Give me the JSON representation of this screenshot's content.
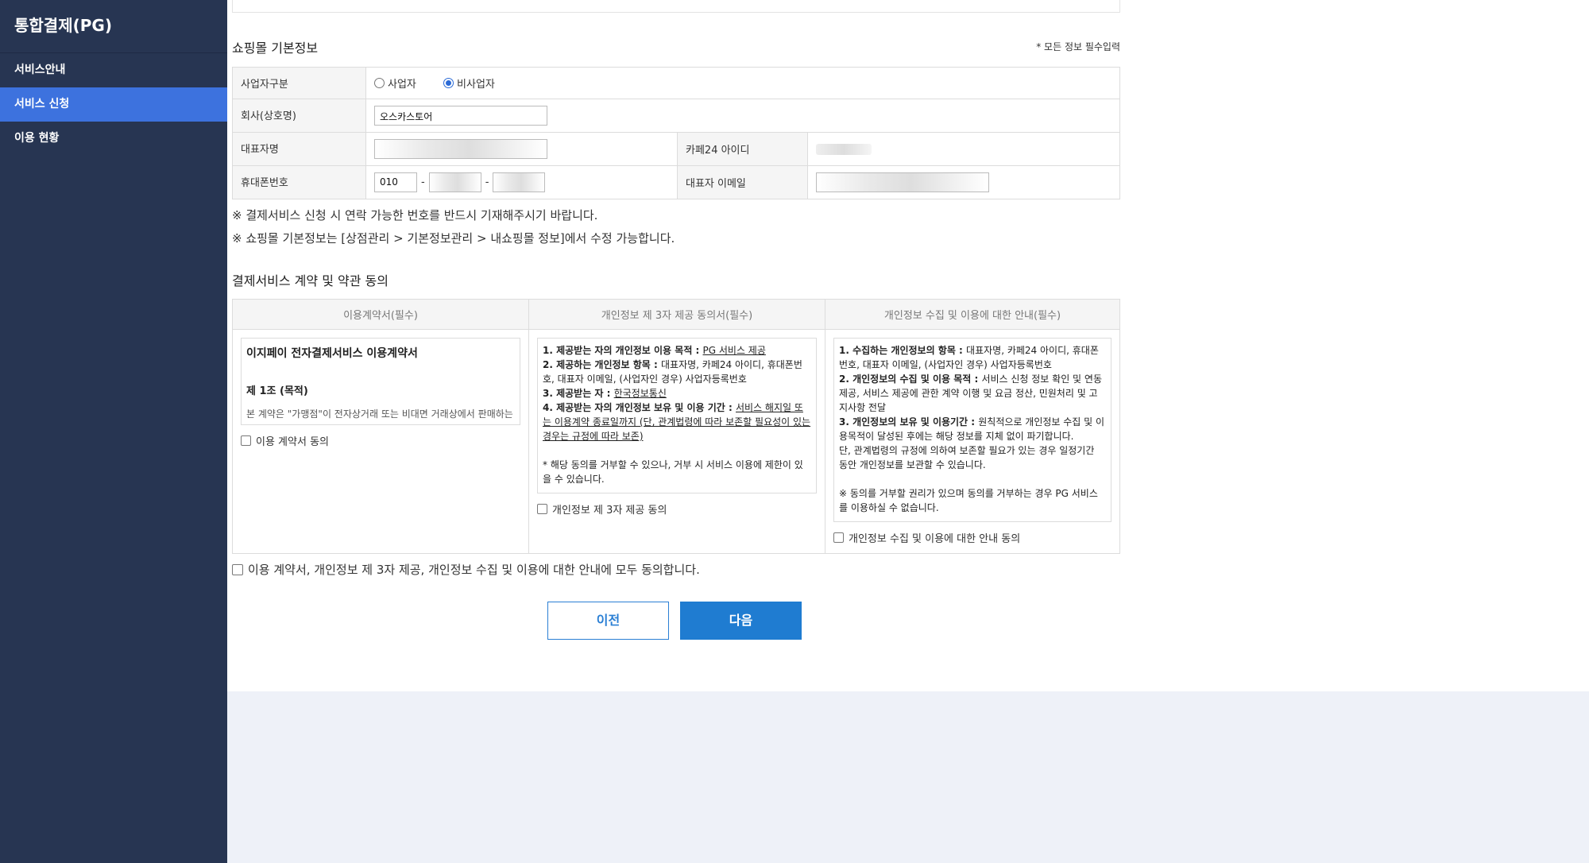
{
  "sidebar": {
    "title": "통합결제(PG)",
    "items": [
      {
        "label": "서비스안내",
        "active": false
      },
      {
        "label": "서비스 신청",
        "active": true
      },
      {
        "label": "이용 현황",
        "active": false
      }
    ]
  },
  "basic_info": {
    "title": "쇼핑몰 기본정보",
    "required_note": "* 모든 정보 필수입력",
    "business_type_label": "사업자구분",
    "business_options": [
      {
        "label": "사업자",
        "selected": false
      },
      {
        "label": "비사업자",
        "selected": true
      }
    ],
    "company_label": "회사(상호명)",
    "company_value": "오스카스토어",
    "ceo_label": "대표자명",
    "cafe24_id_label": "카페24 아이디",
    "phone_label": "휴대폰번호",
    "phone_prefix": "010",
    "phone_sep": "-",
    "ceo_email_label": "대표자 이메일"
  },
  "notices": [
    "※ 결제서비스 신청 시 연락 가능한 번호를 반드시 기재해주시기 바랍니다.",
    "※ 쇼핑몰 기본정보는 [상점관리 > 기본정보관리 > 내쇼핑몰 정보]에서 수정 가능합니다."
  ],
  "agreement": {
    "title": "결제서비스 계약 및 약관 동의",
    "columns": [
      "이용계약서(필수)",
      "개인정보 제 3자 제공 동의서(필수)",
      "개인정보 수집 및 이용에 대한 안내(필수)"
    ],
    "contract": {
      "heading": "이지페이 전자결제서비스 이용계약서",
      "article": "제 1조 (목적)",
      "text": "본 계약은 \"가맹점\"이 전자상거래 또는 비대면 거래상에서 판매하는",
      "checkbox": "이용 계약서 동의"
    },
    "third_party": {
      "l1_b": "1. 제공받는 자의 개인정보 이용 목적 : ",
      "l1_u": "PG 서비스 제공",
      "l2_b": "2. 제공하는 개인정보 항목 : ",
      "l2_t": "대표자명, 카페24 아이디, 휴대폰번호, 대표자 이메일, (사업자인 경우) 사업자등록번호",
      "l3_b": "3. 제공받는 자 : ",
      "l3_u": "한국정보통신",
      "l4_b": "4. 제공받는 자의 개인정보 보유 및 이용 기간 : ",
      "l4_u": "서비스 해지일 또는 이용계약 종료일까지 (단, 관계법령에 따라 보존할 필요성이 있는 경우는 규정에 따라 보존)",
      "note": "* 해당 동의를 거부할 수 있으나, 거부 시 서비스 이용에 제한이 있을 수 있습니다.",
      "checkbox": "개인정보 제 3자 제공 동의"
    },
    "collection": {
      "l1_b": "1. 수집하는 개인정보의 항목 : ",
      "l1_t": "대표자명, 카페24 아이디, 휴대폰번호, 대표자 이메일, (사업자인 경우) 사업자등록번호",
      "l2_b": "2. 개인정보의 수집 및 이용 목적 : ",
      "l2_t": "서비스 신청 정보 확인 및 연동 제공, 서비스 제공에 관한 계약 이행 및 요금 정산, 민원처리 및 고지사항 전달",
      "l3_b": "3. 개인정보의 보유 및 이용기간 : ",
      "l3_t": "원칙적으로 개인정보 수집 및 이용목적이 달성된 후에는 해당 정보를 지체 없이 파기합니다.",
      "l3_t2": "단, 관계법령의 규정에 의하여 보존할 필요가 있는 경우 일정기간 동안 개인정보를 보관할 수 있습니다.",
      "note": "※ 동의를 거부할 권리가 있으며 동의를 거부하는 경우 PG 서비스를 이용하실 수 없습니다.",
      "checkbox": "개인정보 수집 및 이용에 대한 안내 동의"
    },
    "all_agree": "이용 계약서, 개인정보 제 3자 제공, 개인정보 수집 및 이용에 대한 안내에 모두 동의합니다."
  },
  "buttons": {
    "prev": "이전",
    "next": "다음"
  }
}
